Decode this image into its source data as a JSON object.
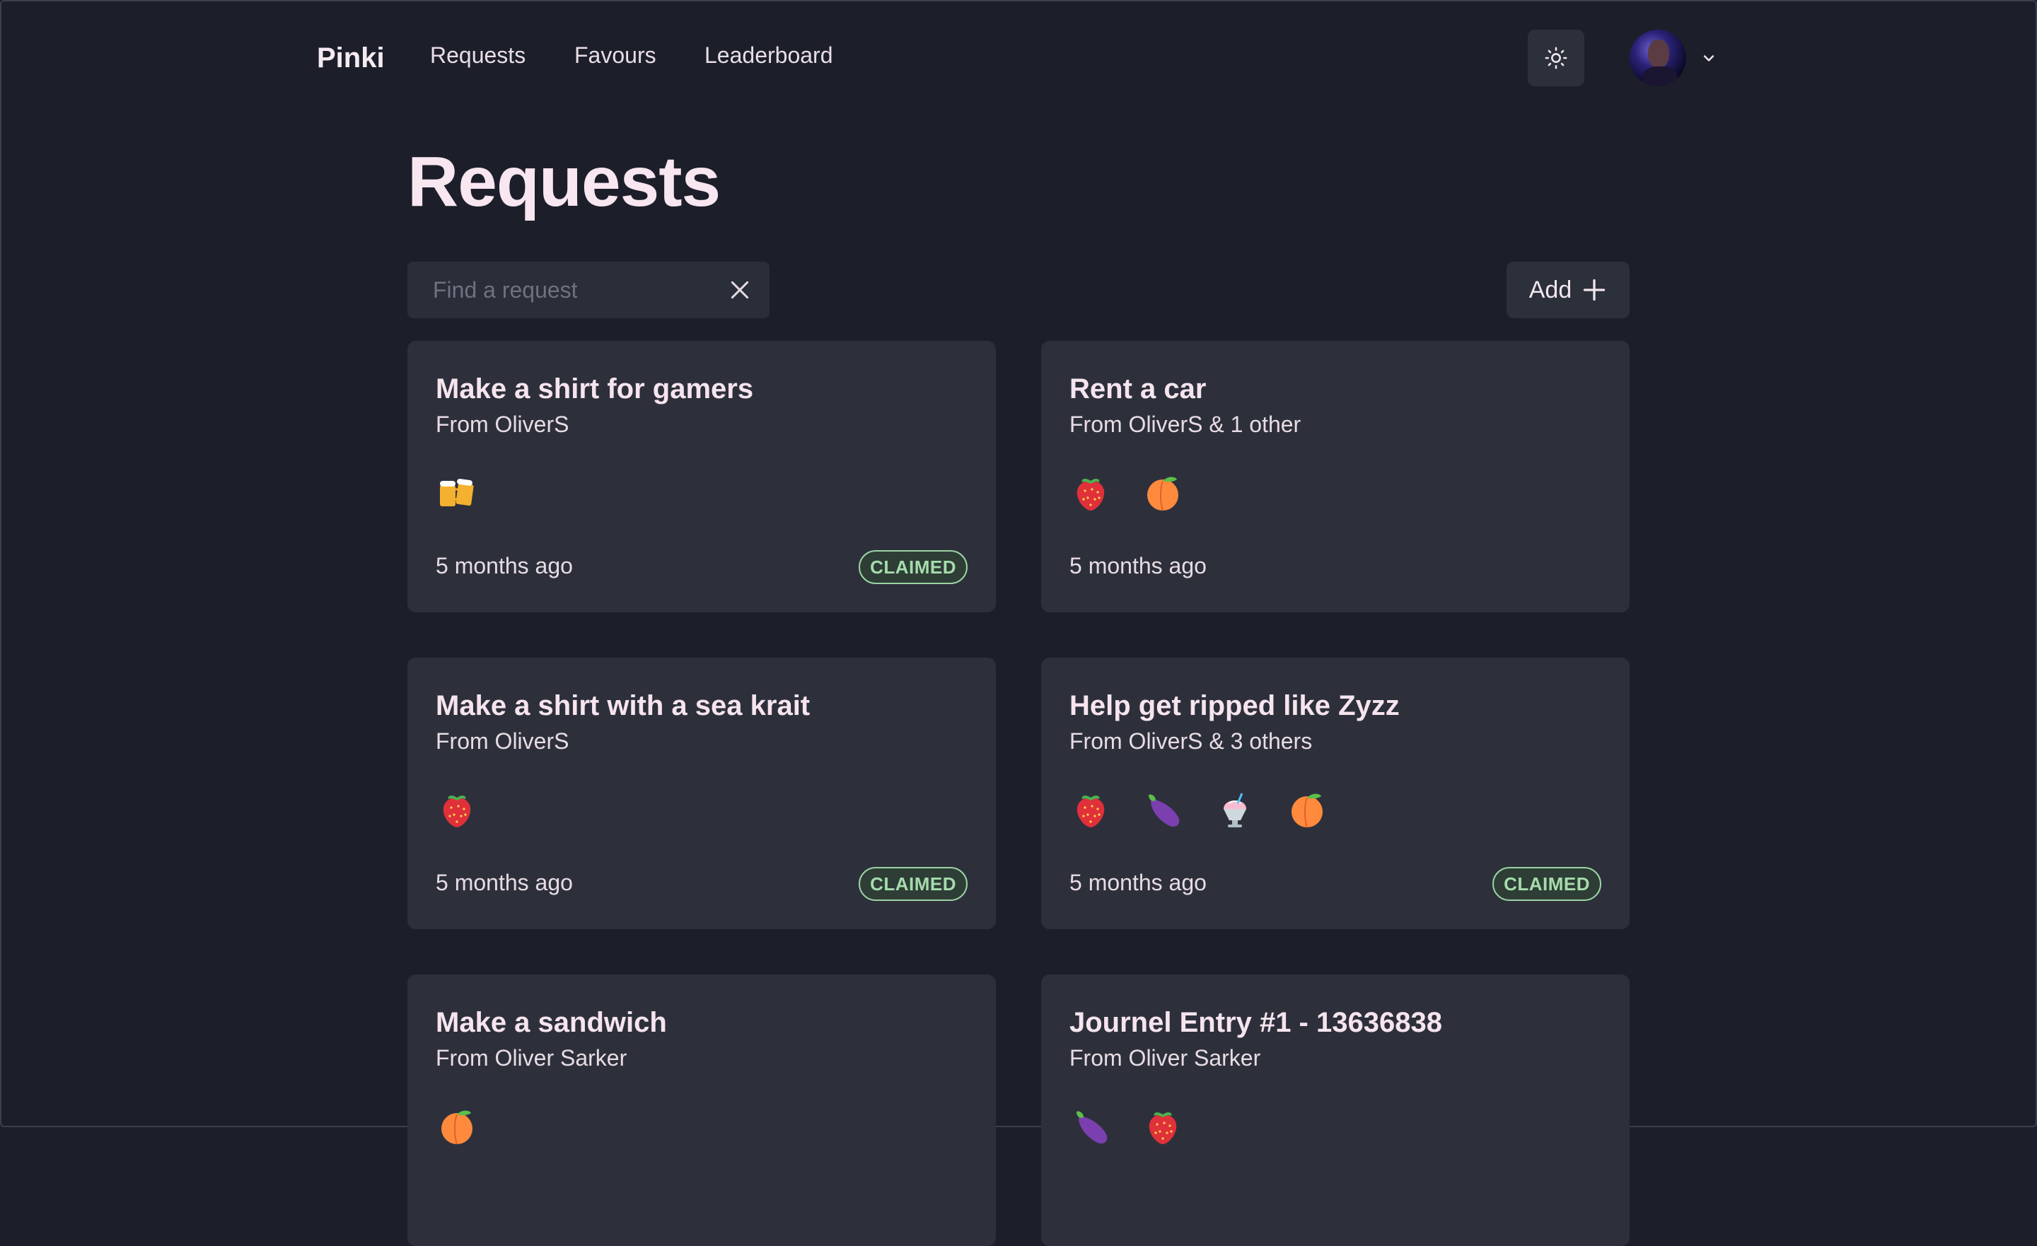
{
  "app": {
    "brand": "Pinki"
  },
  "nav": {
    "links": [
      "Requests",
      "Favours",
      "Leaderboard"
    ]
  },
  "page": {
    "title": "Requests",
    "search_placeholder": "Find a request",
    "add_label": "Add"
  },
  "cards": [
    {
      "title": "Make a shirt for gamers",
      "from": "From OliverS",
      "emojis": [
        "beer-mugs"
      ],
      "time": "5 months ago",
      "badge": "CLAIMED"
    },
    {
      "title": "Rent a car",
      "from": "From OliverS & 1 other",
      "emojis": [
        "strawberry",
        "peach"
      ],
      "time": "5 months ago",
      "badge": ""
    },
    {
      "title": "Make a shirt with a sea krait",
      "from": "From OliverS",
      "emojis": [
        "strawberry"
      ],
      "time": "5 months ago",
      "badge": "CLAIMED"
    },
    {
      "title": "Help get ripped like Zyzz",
      "from": "From OliverS & 3 others",
      "emojis": [
        "strawberry",
        "eggplant",
        "shaved-ice",
        "peach"
      ],
      "time": "5 months ago",
      "badge": "CLAIMED"
    },
    {
      "title": "Make a sandwich",
      "from": "From Oliver Sarker",
      "emojis": [
        "peach"
      ],
      "time": "",
      "badge": ""
    },
    {
      "title": "Journel Entry #1 - 13636838",
      "from": "From Oliver Sarker",
      "emojis": [
        "eggplant",
        "strawberry"
      ],
      "time": "",
      "badge": ""
    }
  ],
  "colors": {
    "background": "#1c1f2a",
    "card": "#2d303b",
    "title_text": "#f8e6f0",
    "badge_border": "#9bd3a3",
    "badge_text": "#a5dcad"
  }
}
